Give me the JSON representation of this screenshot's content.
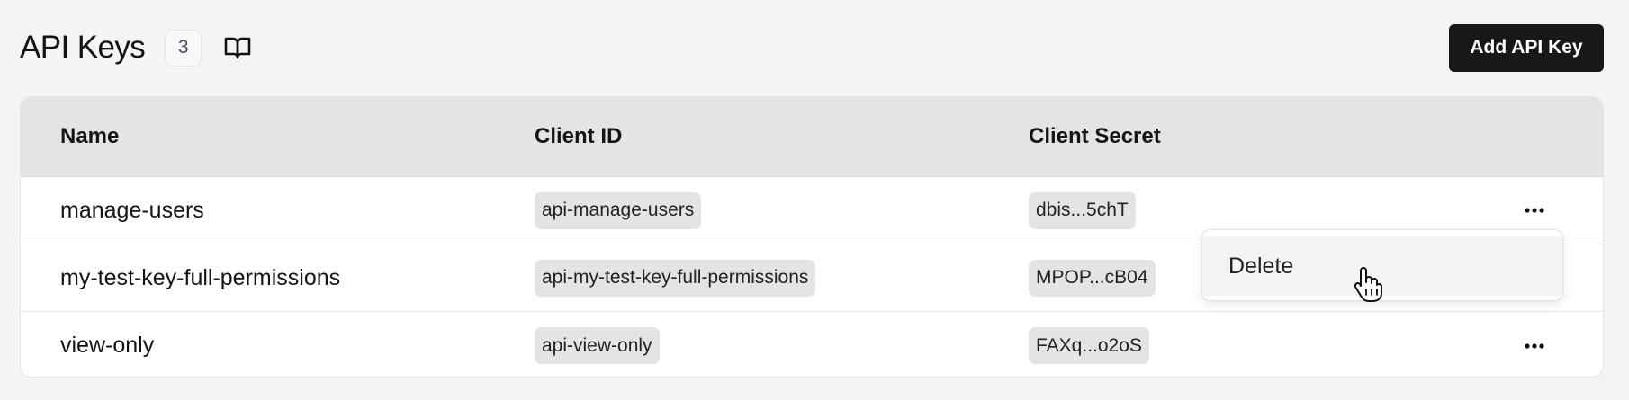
{
  "header": {
    "title": "API Keys",
    "count": "3",
    "add_button_label": "Add API Key"
  },
  "table": {
    "columns": [
      "Name",
      "Client ID",
      "Client Secret"
    ],
    "rows": [
      {
        "name": "manage-users",
        "client_id": "api-manage-users",
        "client_secret": "dbis...5chT"
      },
      {
        "name": "my-test-key-full-permissions",
        "client_id": "api-my-test-key-full-permissions",
        "client_secret": "MPOP...cB04"
      },
      {
        "name": "view-only",
        "client_id": "api-view-only",
        "client_secret": "FAXq...o2oS"
      }
    ]
  },
  "row_menu": {
    "open_for_row": 0,
    "items": [
      {
        "label": "Delete"
      }
    ]
  },
  "icons": {
    "docs": "book-open-icon",
    "row_actions": "more-horizontal-icon",
    "cursor": "hand-pointer-cursor"
  },
  "colors": {
    "primary_button": "#18181b",
    "header_bg": "#e4e4e7",
    "chip_bg": "#e4e4e7",
    "page_bg": "#f4f4f3"
  }
}
